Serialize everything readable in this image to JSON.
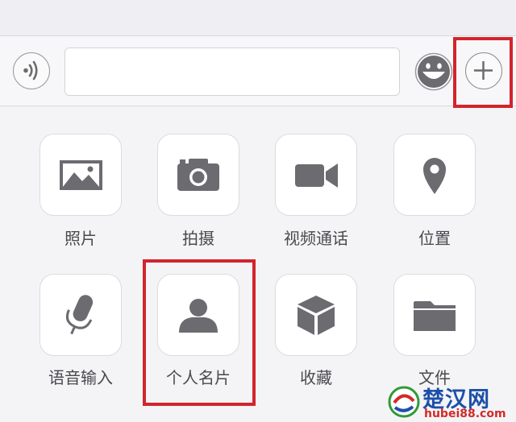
{
  "input_bar": {
    "voice_icon": "voice-wave-icon",
    "text_value": "",
    "emoji_icon": "smiley-face-icon",
    "plus_icon": "plus-circle-icon"
  },
  "panel": {
    "items": [
      {
        "label": "照片",
        "icon": "photo-icon"
      },
      {
        "label": "拍摄",
        "icon": "camera-icon"
      },
      {
        "label": "视频通话",
        "icon": "video-camera-icon"
      },
      {
        "label": "位置",
        "icon": "location-pin-icon"
      },
      {
        "label": "语音输入",
        "icon": "microphone-icon"
      },
      {
        "label": "个人名片",
        "icon": "person-icon"
      },
      {
        "label": "收藏",
        "icon": "cube-icon"
      },
      {
        "label": "文件",
        "icon": "folder-icon"
      }
    ]
  },
  "watermark": {
    "title": "楚汉网",
    "url": "hubei88.com"
  },
  "colors": {
    "icon_gray": "#6b6b70",
    "highlight_red": "#d3242c",
    "watermark_blue": "#1c4fa8"
  }
}
